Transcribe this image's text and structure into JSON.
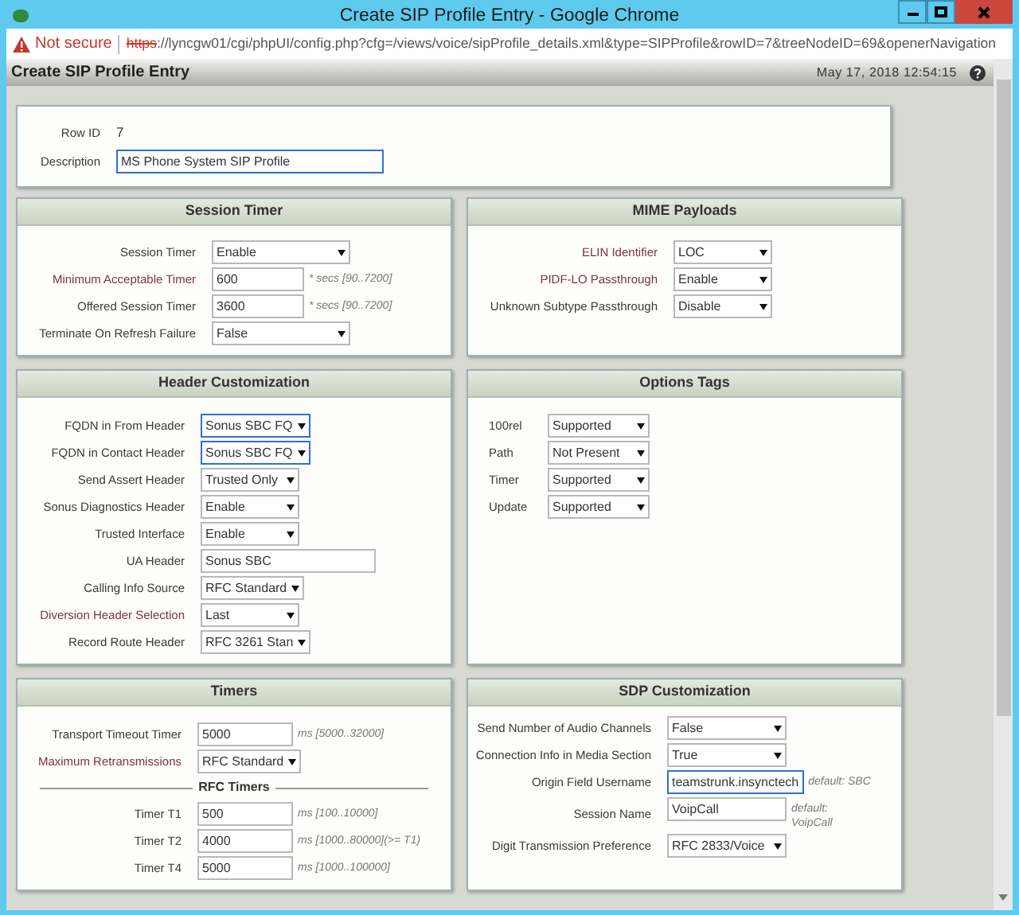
{
  "window": {
    "title": "Create SIP Profile Entry - Google Chrome"
  },
  "address_bar": {
    "security": "Not secure",
    "scheme": "https",
    "url_rest": "://lyncgw01/cgi/phpUI/config.php?cfg=/views/voice/sipProfile_details.xml&type=SIPProfile&rowID=7&treeNodeID=69&openerNavigation"
  },
  "page_header": {
    "title": "Create SIP Profile Entry",
    "timestamp": "May 17, 2018 12:54:15"
  },
  "summary": {
    "rows": [
      {
        "label": "Row ID",
        "kind": "static",
        "value": "7",
        "emphasized": false
      },
      {
        "label": "Description",
        "kind": "text",
        "value": "MS Phone System SIP Profile",
        "emphasized": false,
        "highlighted": true
      }
    ]
  },
  "panels": [
    {
      "title": "Session Timer",
      "rows": [
        {
          "label": "Session Timer",
          "kind": "select",
          "value": "Enable",
          "emphasized": false,
          "highlighted": false
        },
        {
          "label": "Minimum Acceptable Timer",
          "kind": "text",
          "value": "600",
          "hint": "* secs [90..7200]",
          "emphasized": true,
          "highlighted": false
        },
        {
          "label": "Offered Session Timer",
          "kind": "text",
          "value": "3600",
          "hint": "* secs [90..7200]",
          "emphasized": false,
          "highlighted": false
        },
        {
          "label": "Terminate On Refresh Failure",
          "kind": "select",
          "value": "False",
          "emphasized": false,
          "highlighted": false
        }
      ]
    },
    {
      "title": "MIME Payloads",
      "rows": [
        {
          "label": "ELIN Identifier",
          "kind": "select",
          "value": "LOC",
          "emphasized": true,
          "highlighted": false
        },
        {
          "label": "PIDF-LO Passthrough",
          "kind": "select",
          "value": "Enable",
          "emphasized": true,
          "highlighted": false
        },
        {
          "label": "Unknown Subtype Passthrough",
          "kind": "select",
          "value": "Disable",
          "emphasized": false,
          "highlighted": false
        }
      ]
    },
    {
      "title": "Header Customization",
      "rows": [
        {
          "label": "FQDN in From Header",
          "kind": "select",
          "value": "Sonus SBC FQ",
          "emphasized": false,
          "highlighted": true
        },
        {
          "label": "FQDN in Contact Header",
          "kind": "select",
          "value": "Sonus SBC FQ",
          "emphasized": false,
          "highlighted": true
        },
        {
          "label": "Send Assert Header",
          "kind": "select",
          "value": "Trusted Only",
          "emphasized": false,
          "highlighted": false
        },
        {
          "label": "Sonus Diagnostics Header",
          "kind": "select",
          "value": "Enable",
          "emphasized": false,
          "highlighted": false
        },
        {
          "label": "Trusted Interface",
          "kind": "select",
          "value": "Enable",
          "emphasized": false,
          "highlighted": false
        },
        {
          "label": "UA Header",
          "kind": "text",
          "value": "Sonus SBC",
          "emphasized": false,
          "highlighted": false
        },
        {
          "label": "Calling Info Source",
          "kind": "select",
          "value": "RFC Standard",
          "emphasized": false,
          "highlighted": false
        },
        {
          "label": "Diversion Header Selection",
          "kind": "select",
          "value": "Last",
          "emphasized": true,
          "highlighted": false
        },
        {
          "label": "Record Route Header",
          "kind": "select",
          "value": "RFC 3261 Stan",
          "emphasized": false,
          "highlighted": false
        }
      ]
    },
    {
      "title": "Options Tags",
      "rows": [
        {
          "label": "100rel",
          "kind": "select",
          "value": "Supported",
          "emphasized": false,
          "highlighted": false
        },
        {
          "label": "Path",
          "kind": "select",
          "value": "Not Present",
          "emphasized": false,
          "highlighted": false
        },
        {
          "label": "Timer",
          "kind": "select",
          "value": "Supported",
          "emphasized": false,
          "highlighted": false
        },
        {
          "label": "Update",
          "kind": "select",
          "value": "Supported",
          "emphasized": false,
          "highlighted": false
        }
      ]
    },
    {
      "title": "Timers",
      "rows": [
        {
          "label": "Transport Timeout Timer",
          "kind": "text",
          "value": "5000",
          "hint": "ms [5000..32000]",
          "emphasized": false,
          "highlighted": false
        },
        {
          "label": "Maximum Retransmissions",
          "kind": "select",
          "value": "RFC Standard",
          "emphasized": true,
          "highlighted": false
        },
        {
          "label": "RFC Timers",
          "kind": "divider"
        },
        {
          "label": "Timer T1",
          "kind": "text",
          "value": "500",
          "hint": "ms [100..10000]",
          "emphasized": false,
          "highlighted": false
        },
        {
          "label": "Timer T2",
          "kind": "text",
          "value": "4000",
          "hint": "ms [1000..80000](>= T1)",
          "emphasized": false,
          "highlighted": false
        },
        {
          "label": "Timer T4",
          "kind": "text",
          "value": "5000",
          "hint": "ms [1000..100000]",
          "emphasized": false,
          "highlighted": false
        }
      ]
    },
    {
      "title": "SDP Customization",
      "rows": [
        {
          "label": "Send Number of Audio Channels",
          "kind": "select",
          "value": "False",
          "emphasized": false,
          "highlighted": false
        },
        {
          "label": "Connection Info in Media Section",
          "kind": "select",
          "value": "True",
          "emphasized": false,
          "highlighted": false
        },
        {
          "label": "Origin Field Username",
          "kind": "text",
          "value": "teamstrunk.insynctech",
          "hint": "default: SBC",
          "emphasized": false,
          "highlighted": true
        },
        {
          "label": "Session Name",
          "kind": "text",
          "value": "VoipCall",
          "hint": "default: VoipCall",
          "emphasized": false,
          "highlighted": false
        },
        {
          "label": "Digit Transmission Preference",
          "kind": "select",
          "value": "RFC 2833/Voice",
          "emphasized": false,
          "highlighted": false
        }
      ]
    }
  ]
}
